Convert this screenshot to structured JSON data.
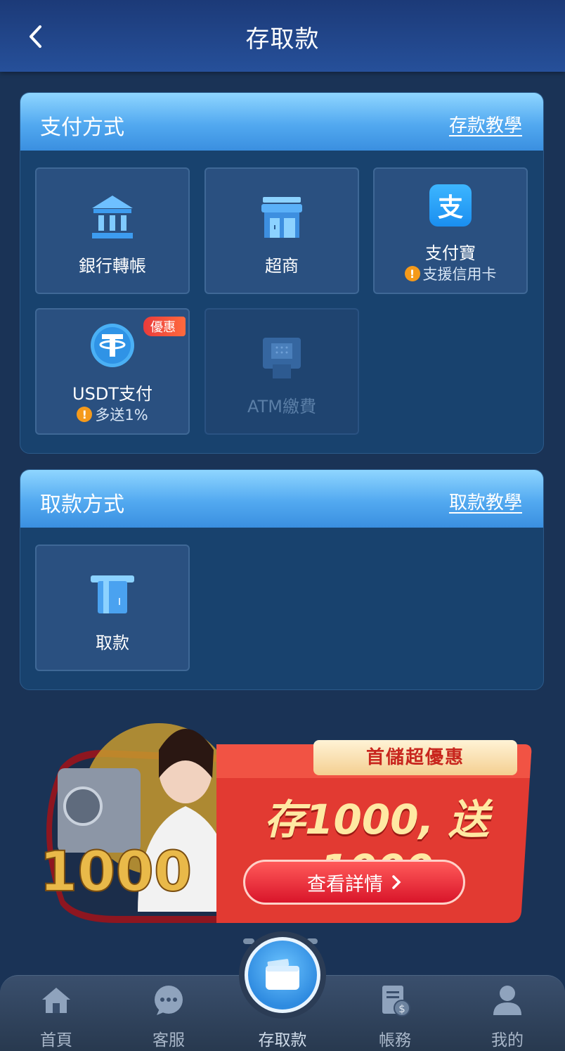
{
  "header": {
    "title": "存取款",
    "back_icon": "chevron-left-icon"
  },
  "deposit": {
    "title": "支付方式",
    "tutorial_link": "存款教學",
    "methods": [
      {
        "label": "銀行轉帳",
        "icon": "bank-icon"
      },
      {
        "label": "超商",
        "icon": "store-icon"
      },
      {
        "label": "支付寶",
        "icon": "alipay-icon",
        "note": "支援信用卡"
      },
      {
        "label": "USDT支付",
        "icon": "usdt-icon",
        "note": "多送1%",
        "badge": "優惠"
      },
      {
        "label": "ATM繳費",
        "icon": "atm-icon",
        "disabled": true
      }
    ]
  },
  "withdraw": {
    "title": "取款方式",
    "tutorial_link": "取款教學",
    "methods": [
      {
        "label": "取款",
        "icon": "card-icon"
      }
    ]
  },
  "banner": {
    "ribbon": "首儲超優惠",
    "promo": "存1000, 送1000",
    "amount_art": "1000",
    "button": "查看詳情"
  },
  "bottom_nav": [
    {
      "label": "首頁",
      "icon": "home-icon"
    },
    {
      "label": "客服",
      "icon": "chat-icon"
    },
    {
      "label": "存取款",
      "icon": "wallet-icon",
      "active": true
    },
    {
      "label": "帳務",
      "icon": "statement-icon"
    },
    {
      "label": "我的",
      "icon": "user-icon"
    }
  ],
  "colors": {
    "background": "#1a3356",
    "section_header": "#52a9f0",
    "warning": "#f59a1a",
    "promo_red": "#d9152a"
  }
}
